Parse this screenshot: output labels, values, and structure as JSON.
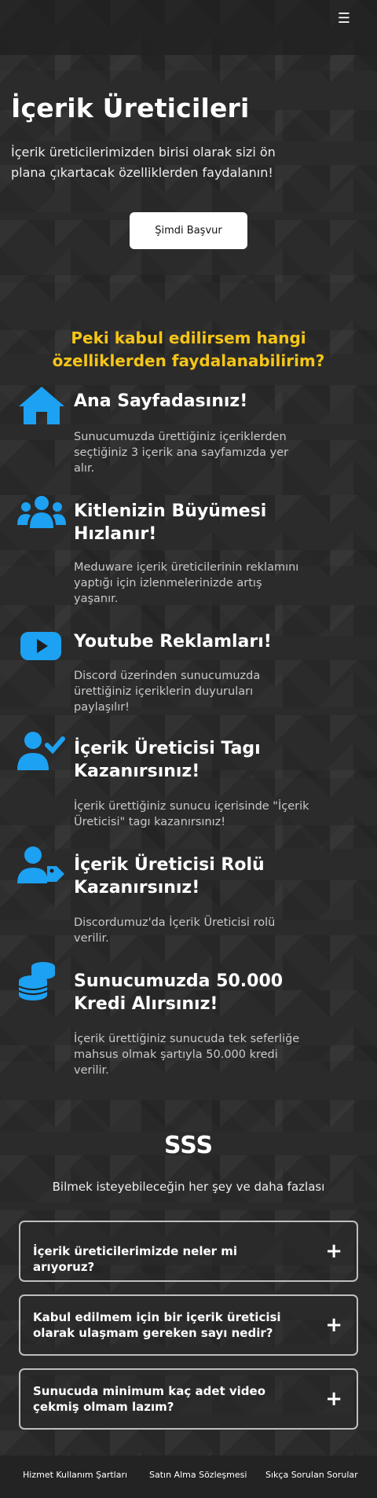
{
  "header": {
    "menu_icon": "hamburger-icon",
    "menu_glyph": "☰"
  },
  "hero": {
    "title": "İçerik Üreticileri",
    "description": "İçerik üreticilerimizden birisi olarak sizi ön plana çıkartacak özelliklerden faydalanın!",
    "apply_label": "Şimdi Başvur"
  },
  "features": {
    "title": "Peki kabul edilirsem hangi özelliklerden faydalanabilirim?",
    "accent_color": "#f5c518",
    "icon_color": "#1da1f2",
    "items": [
      {
        "icon": "home-icon",
        "title": "Ana Sayfadasınız!",
        "text": "Sunucumuzda ürettiğiniz içeriklerden seçtiğiniz 3 içerik ana sayfamızda yer alır."
      },
      {
        "icon": "users-icon",
        "title": "Kitlenizin Büyümesi Hızlanır!",
        "text": "Meduware içerik üreticilerinin reklamını yaptığı için izlenmelerinizde artış yaşanır."
      },
      {
        "icon": "youtube-icon",
        "title": "Youtube Reklamları!",
        "text": "Discord üzerinden sunucumuzda ürettiğiniz içeriklerin duyuruları paylaşılır!"
      },
      {
        "icon": "user-check-icon",
        "title": "İçerik Üreticisi Tagı Kazanırsınız!",
        "text": "İçerik ürettiğiniz sunucu içerisinde \"İçerik Üreticisi\" tagı kazanırsınız!"
      },
      {
        "icon": "user-tag-icon",
        "title": "İçerik Üreticisi Rolü Kazanırsınız!",
        "text": "Discordumuz'da İçerik Üreticisi rolü verilir."
      },
      {
        "icon": "coins-icon",
        "title": "Sunucumuzda 50.000 Kredi Alırsınız!",
        "text": "İçerik ürettiğiniz sunucuda tek seferliğe mahsus olmak şartıyla 50.000 kredi verilir."
      }
    ]
  },
  "faq": {
    "title": "SSS",
    "subtitle": "Bilmek isteyebileceğin her şey ve daha fazlası",
    "toggle_glyph": "+",
    "items": [
      {
        "question": "İçerik üreticilerimizde neler mi arıyoruz?"
      },
      {
        "question": "Kabul edilmem için bir içerik üreticisi olarak ulaşmam gereken sayı nedir?"
      },
      {
        "question": "Sunucuda minimum kaç adet video çekmiş olmam lazım?"
      }
    ]
  },
  "footer": {
    "links": [
      "Hizmet Kullanım Şartları",
      "Satın Alma Sözleşmesi",
      "Sıkça Sorulan Sorular"
    ]
  }
}
